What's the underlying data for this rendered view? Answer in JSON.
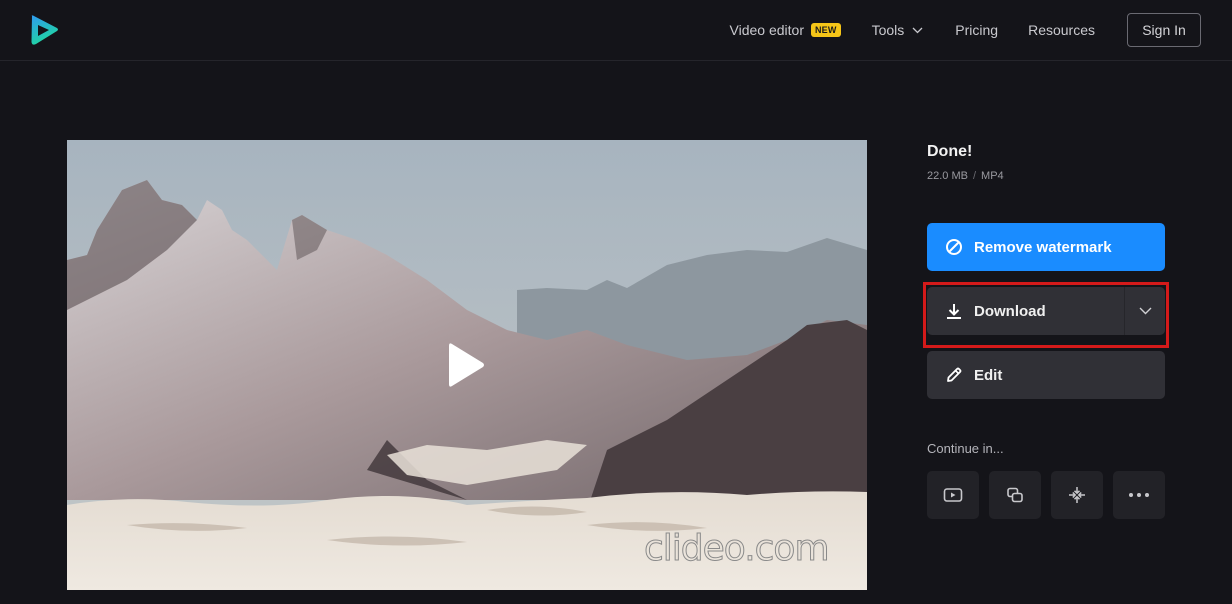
{
  "header": {
    "logo_icon": "clideo-play-logo-icon",
    "nav": {
      "video_editor": "Video editor",
      "new_badge": "NEW",
      "tools": "Tools",
      "pricing": "Pricing",
      "resources": "Resources",
      "sign_in": "Sign In"
    }
  },
  "video": {
    "watermark": "clideo.com",
    "play_icon": "play-icon"
  },
  "result": {
    "title": "Done!",
    "size": "22.0 MB",
    "separator": "/",
    "format": "MP4",
    "buttons": {
      "remove_watermark": "Remove watermark",
      "download": "Download",
      "edit": "Edit"
    },
    "continue_label": "Continue in...",
    "continue_tools": [
      {
        "icon": "video-player-icon"
      },
      {
        "icon": "merge-icon"
      },
      {
        "icon": "compress-icon"
      },
      {
        "icon": "more-icon"
      }
    ]
  },
  "colors": {
    "background": "#141419",
    "accent_blue": "#1a8cff",
    "button_dark": "#303036",
    "new_badge": "#f5c518",
    "highlight_red": "#d41a1a"
  }
}
